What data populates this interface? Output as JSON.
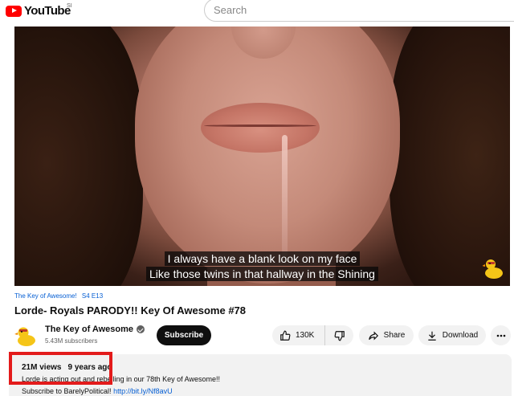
{
  "header": {
    "logo_text": "YouTube",
    "country_code": "SI",
    "search_placeholder": "Search"
  },
  "video": {
    "subtitle_line1": "I always have a blank look on my face",
    "subtitle_line2": "Like those twins in that hallway in the Shining",
    "watermark_icon": "rubber-duck-icon"
  },
  "meta": {
    "series_label": "The Key of Awesome!",
    "episode_label": "S4 E13",
    "title": "Lorde- Royals PARODY!! Key Of Awesome #78"
  },
  "channel": {
    "name": "The Key of Awesome",
    "subscribers": "5.43M subscribers",
    "subscribe_label": "Subscribe"
  },
  "actions": {
    "like_count": "130K",
    "share_label": "Share",
    "download_label": "Download"
  },
  "description": {
    "views": "21M views",
    "age": "9 years ago",
    "line1": "Lorde is acting out and rebelling in our 78th Key of Awesome!!",
    "line2_prefix": "Subscribe to BarelyPolitical!",
    "line2_link": "http://bit.ly/Nf8avU"
  },
  "colors": {
    "brand_red": "#ff0000",
    "link_blue": "#065fd4",
    "highlight_red": "#e31b1b"
  }
}
